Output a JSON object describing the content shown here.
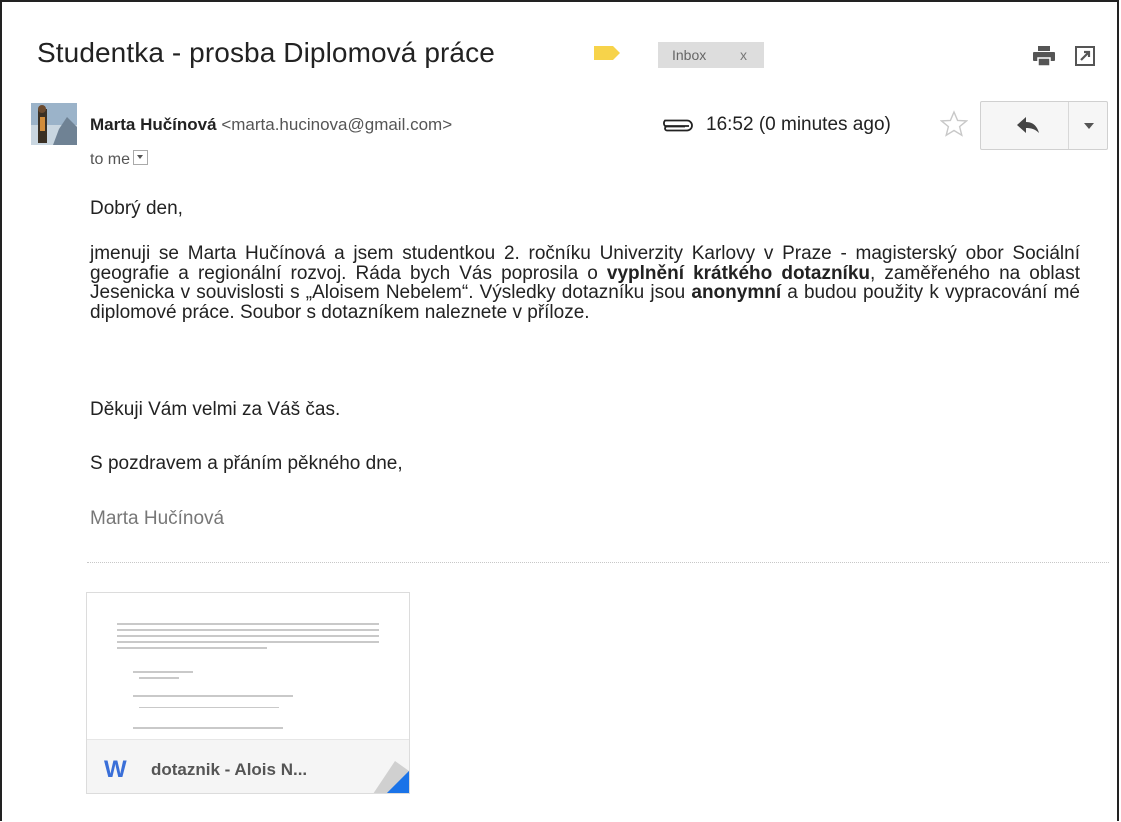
{
  "header": {
    "subject": "Studentka - prosba Diplomová práce",
    "label_chip": "Inbox",
    "label_chip_close": "x",
    "label_color": "#f7d34a"
  },
  "message": {
    "sender_name": "Marta Hučínová",
    "sender_email": "<marta.hucinova@gmail.com>",
    "time": "16:52 (0 minutes ago)",
    "to_me": "to me",
    "greeting": "Dobrý den,",
    "para_1": "jmenuji se Marta Hučínová a jsem studentkou 2. ročníku Univerzity Karlovy v Praze - magisterský obor Sociální geografie a regionální rozvoj. Ráda bych Vás poprosila o ",
    "para_bold_1": "vyplnění krátkého dotazníku",
    "para_2": ", zaměřeného na oblast Jesenicka v souvislosti s „Aloisem Nebelem“. Výsledky dotazníku jsou ",
    "para_bold_2": "anonymní",
    "para_3": " a budou použity k vypracování mé diplomové práce. Soubor s dotazníkem naleznete v příloze.",
    "thanks": "Děkuji Vám velmi za Váš čas.",
    "regards": "S pozdravem a přáním pěkného dne,",
    "signature": "Marta Hučínová"
  },
  "attachment": {
    "file_name": "dotaznik - Alois N...",
    "file_type_icon": "W",
    "icon_color": "#3a6fd8",
    "corner_color": "#1a73e8"
  },
  "icons": {
    "print": "print-icon",
    "popout": "popout-icon",
    "attachment": "paperclip-icon",
    "star": "star-icon",
    "reply": "reply-icon",
    "more": "chevron-down-icon"
  }
}
